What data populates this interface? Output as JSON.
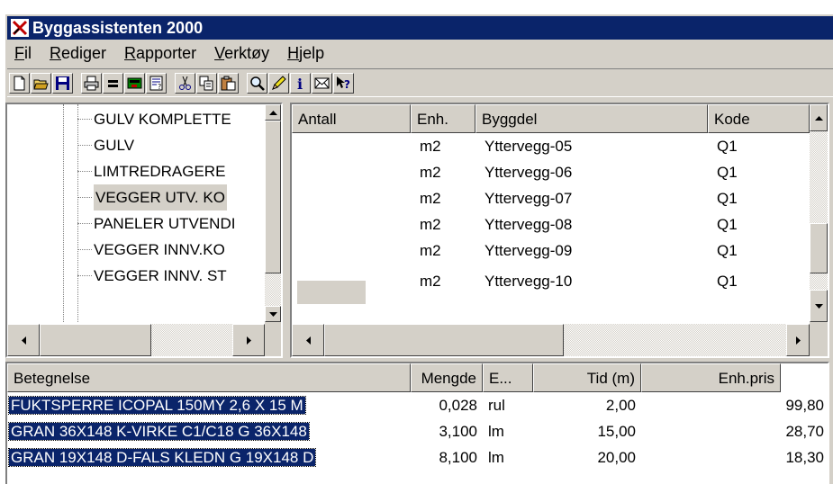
{
  "window": {
    "title": "Byggassistenten 2000"
  },
  "menubar": {
    "items": [
      {
        "acc": "F",
        "rest": "il"
      },
      {
        "acc": "R",
        "rest": "ediger"
      },
      {
        "acc": "R",
        "rest": "apporter"
      },
      {
        "acc": "V",
        "rest": "erktøy"
      },
      {
        "acc": "H",
        "rest": "jelp"
      }
    ]
  },
  "toolbar": {
    "buttons": [
      "new-icon",
      "open-icon",
      "save-icon",
      "print-icon",
      "equals-icon",
      "green-doc-icon",
      "calc-icon",
      "cut-icon",
      "copy-icon",
      "paste-icon",
      "find-icon",
      "edit-icon",
      "info-icon",
      "mail-icon",
      "whats-this-icon"
    ]
  },
  "tree": {
    "items": [
      {
        "label": "GULV KOMPLETTE"
      },
      {
        "label": "GULV"
      },
      {
        "label": "LIMTREDRAGERE"
      },
      {
        "label": "VEGGER UTV. KO",
        "selected": true
      },
      {
        "label": "PANELER UTVENDI"
      },
      {
        "label": "VEGGER INNV.KO"
      },
      {
        "label": "VEGGER INNV. ST"
      }
    ]
  },
  "grid": {
    "columns": [
      "Antall",
      "Enh.",
      "Byggdel",
      "Kode"
    ],
    "rows": [
      {
        "antall": "",
        "enh": "m2",
        "byggdel": "Yttervegg-05",
        "kode": "Q1"
      },
      {
        "antall": "",
        "enh": "m2",
        "byggdel": "Yttervegg-06",
        "kode": "Q1"
      },
      {
        "antall": "",
        "enh": "m2",
        "byggdel": "Yttervegg-07",
        "kode": "Q1"
      },
      {
        "antall": "",
        "enh": "m2",
        "byggdel": "Yttervegg-08",
        "kode": "Q1"
      },
      {
        "antall": "",
        "enh": "m2",
        "byggdel": "Yttervegg-09",
        "kode": "Q1"
      },
      {
        "antall": "",
        "enh": "m2",
        "byggdel": "Yttervegg-10",
        "kode": "Q1"
      }
    ]
  },
  "list": {
    "columns": [
      "Betegnelse",
      "Mengde",
      "E...",
      "Tid (m)",
      "Enh.pris"
    ],
    "rows": [
      {
        "betegnelse": "FUKTSPERRE ICOPAL 150MY 2,6 X 15 M",
        "mengde": "0,028",
        "enhet": "rul",
        "tid": "2,00",
        "pris": "99,80"
      },
      {
        "betegnelse": "GRAN 36X148 K-VIRKE C1/C18 G 36X148",
        "mengde": "3,100",
        "enhet": "lm",
        "tid": "15,00",
        "pris": "28,70"
      },
      {
        "betegnelse": "GRAN 19X148 D-FALS KLEDN G 19X148 D",
        "mengde": "8,100",
        "enhet": "lm",
        "tid": "20,00",
        "pris": "18,30"
      }
    ]
  },
  "colors": {
    "titlebar": "#0a246a",
    "face": "#d4d0c8",
    "selection": "#0a246a"
  }
}
